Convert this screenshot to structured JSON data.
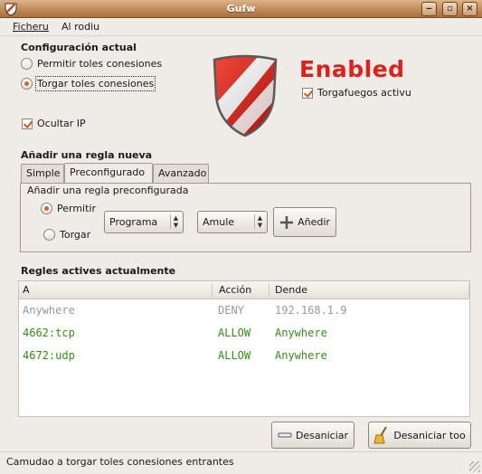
{
  "window": {
    "title": "Gufw"
  },
  "menubar": {
    "items": [
      {
        "label": "Ficheru"
      },
      {
        "label": "Al rodiu"
      }
    ]
  },
  "config": {
    "title": "Configuración actual",
    "allow_all": "Permitir toles conesiones",
    "deny_all": "Torgar toles conesiones",
    "selected": "deny_all",
    "hide_ip": "Ocultar IP",
    "hide_ip_checked": true
  },
  "firewall": {
    "status_text": "Enabled",
    "status_color": "#e0201b",
    "active_label": "Torgafuegos activu",
    "active_checked": true
  },
  "new_rule": {
    "title": "Añadir una regla nueva",
    "tabs": [
      {
        "label": "Simple"
      },
      {
        "label": "Preconfigurado"
      },
      {
        "label": "Avanzado"
      }
    ],
    "active_tab": "Preconfigurado",
    "panel_title": "Añadir una regla preconfigurada",
    "permit": "Permitir",
    "deny": "Torgar",
    "selected": "permit",
    "program_value": "Programa",
    "direction_value": "Amule",
    "add_button": "Añedir"
  },
  "rules": {
    "title": "Regles actives actualmente",
    "columns": [
      "A",
      "Acción",
      "Dende"
    ],
    "rows": [
      {
        "to": "Anywhere",
        "action": "DENY",
        "from": "192.168.1.9",
        "color": "#9a9a9a"
      },
      {
        "to": "4662:tcp",
        "action": "ALLOW",
        "from": "Anywhere",
        "color": "#3a8a1a"
      },
      {
        "to": "4672:udp",
        "action": "ALLOW",
        "from": "Anywhere",
        "color": "#3a8a1a"
      }
    ]
  },
  "buttons": {
    "remove": "Desaniciar",
    "remove_all": "Desaniciar too"
  },
  "status": {
    "text": "Camudao a torgar toles conesiones entrantes"
  }
}
